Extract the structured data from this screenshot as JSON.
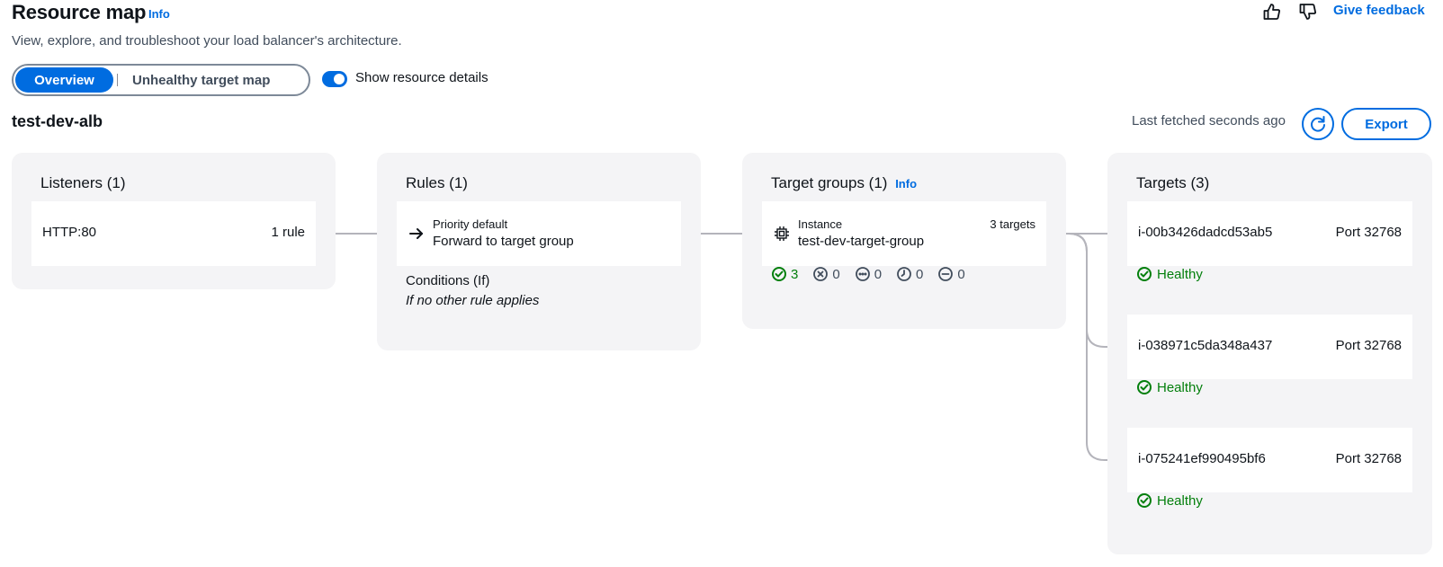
{
  "header": {
    "title": "Resource map",
    "info_label": "Info",
    "description": "View, explore, and troubleshoot your load balancer's architecture.",
    "give_feedback": "Give feedback",
    "thumbs_up_icon": "thumbs-up-icon",
    "thumbs_down_icon": "thumbs-down-icon"
  },
  "view_toggle": {
    "options": [
      "Overview",
      "Unhealthy target map"
    ],
    "selected": "Overview"
  },
  "resource_details_toggle": {
    "label": "Show resource details",
    "enabled": true
  },
  "load_balancer": {
    "name": "test-dev-alb",
    "last_fetched": "Last fetched seconds ago",
    "export_label": "Export",
    "refresh_icon": "refresh-icon"
  },
  "listeners": {
    "title": "Listeners (1)",
    "items": [
      {
        "name": "HTTP:80",
        "rules": "1 rule"
      }
    ]
  },
  "rules": {
    "title": "Rules (1)",
    "items": [
      {
        "priority": "Priority default",
        "action": "Forward to target group",
        "conditions_label": "Conditions (If)",
        "conditions_value": "If no other rule applies",
        "icon": "arrow-right-icon"
      }
    ]
  },
  "target_groups": {
    "title": "Target groups (1)",
    "info_label": "Info",
    "items": [
      {
        "type": "Instance",
        "name": "test-dev-target-group",
        "targets_count": "3 targets",
        "icon": "chip-icon",
        "status_counts": {
          "healthy": "3",
          "unhealthy": "0",
          "unused": "0",
          "pending": "0",
          "draining": "0"
        }
      }
    ]
  },
  "targets": {
    "title": "Targets (3)",
    "items": [
      {
        "id": "i-00b3426dadcd53ab5",
        "port": "Port 32768",
        "status": "Healthy"
      },
      {
        "id": "i-038971c5da348a437",
        "port": "Port 32768",
        "status": "Healthy"
      },
      {
        "id": "i-075241ef990495bf6",
        "port": "Port 32768",
        "status": "Healthy"
      }
    ]
  },
  "colors": {
    "accent": "#006ce0",
    "healthy": "#037f0c",
    "panel_bg": "#f4f4f6",
    "connector": "#b4b4bb"
  }
}
